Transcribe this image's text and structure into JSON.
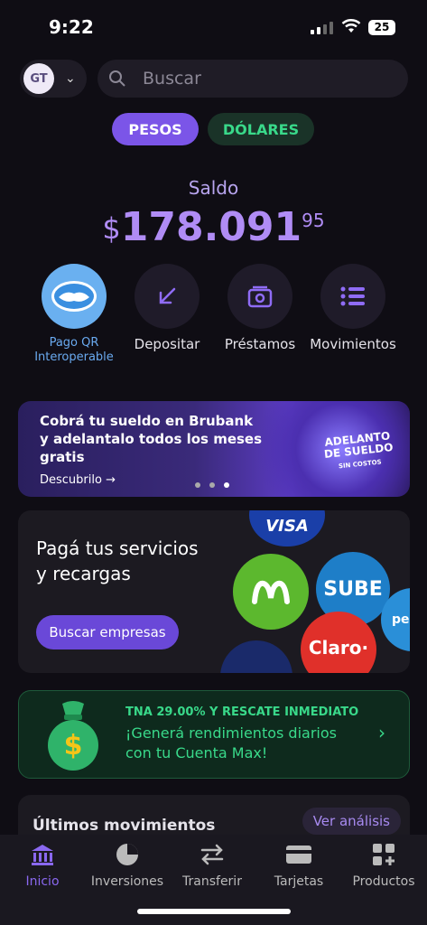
{
  "status": {
    "time": "9:22",
    "battery": "25"
  },
  "account": {
    "initials": "GT"
  },
  "search": {
    "placeholder": "Buscar"
  },
  "currency": {
    "pesos": "PESOS",
    "dollars": "DÓLARES"
  },
  "balance": {
    "label": "Saldo",
    "symbol": "$",
    "integer": "178.091",
    "decimals": "95"
  },
  "actions": [
    {
      "label": "Pago QR Interoperable",
      "icon": "handshake-icon"
    },
    {
      "label": "Depositar",
      "icon": "arrow-down-left-icon"
    },
    {
      "label": "Préstamos",
      "icon": "wallet-icon"
    },
    {
      "label": "Movimientos",
      "icon": "list-icon"
    }
  ],
  "banner": {
    "text": "Cobrá tu sueldo en Brubank y adelantalo todos los meses gratis",
    "cta": "Descubrilo →",
    "tag_line1": "ADELANTO",
    "tag_line2": "DE SUELDO",
    "tag_line3": "SIN COSTOS"
  },
  "services": {
    "title_line1": "Pagá tus servicios",
    "title_line2": "y recargas",
    "button": "Buscar empresas",
    "logos": [
      "VISA",
      "SUBE",
      "Claro·",
      "per"
    ]
  },
  "max": {
    "line1": "TNA 29.00% Y RESCATE INMEDIATO",
    "line2a": "¡Generá rendimientos diarios",
    "line2b": "con tu Cuenta Max!"
  },
  "movements": {
    "title": "Últimos movimientos",
    "analysis": "Ver análisis"
  },
  "tabs": [
    {
      "label": "Inicio",
      "icon": "bank-icon"
    },
    {
      "label": "Inversiones",
      "icon": "pie-chart-icon"
    },
    {
      "label": "Transferir",
      "icon": "transfer-icon"
    },
    {
      "label": "Tarjetas",
      "icon": "card-icon"
    },
    {
      "label": "Productos",
      "icon": "grid-plus-icon"
    }
  ],
  "colors": {
    "accent": "#7b55e8",
    "green": "#39d98a",
    "qr_blue": "#6aaaf0"
  }
}
